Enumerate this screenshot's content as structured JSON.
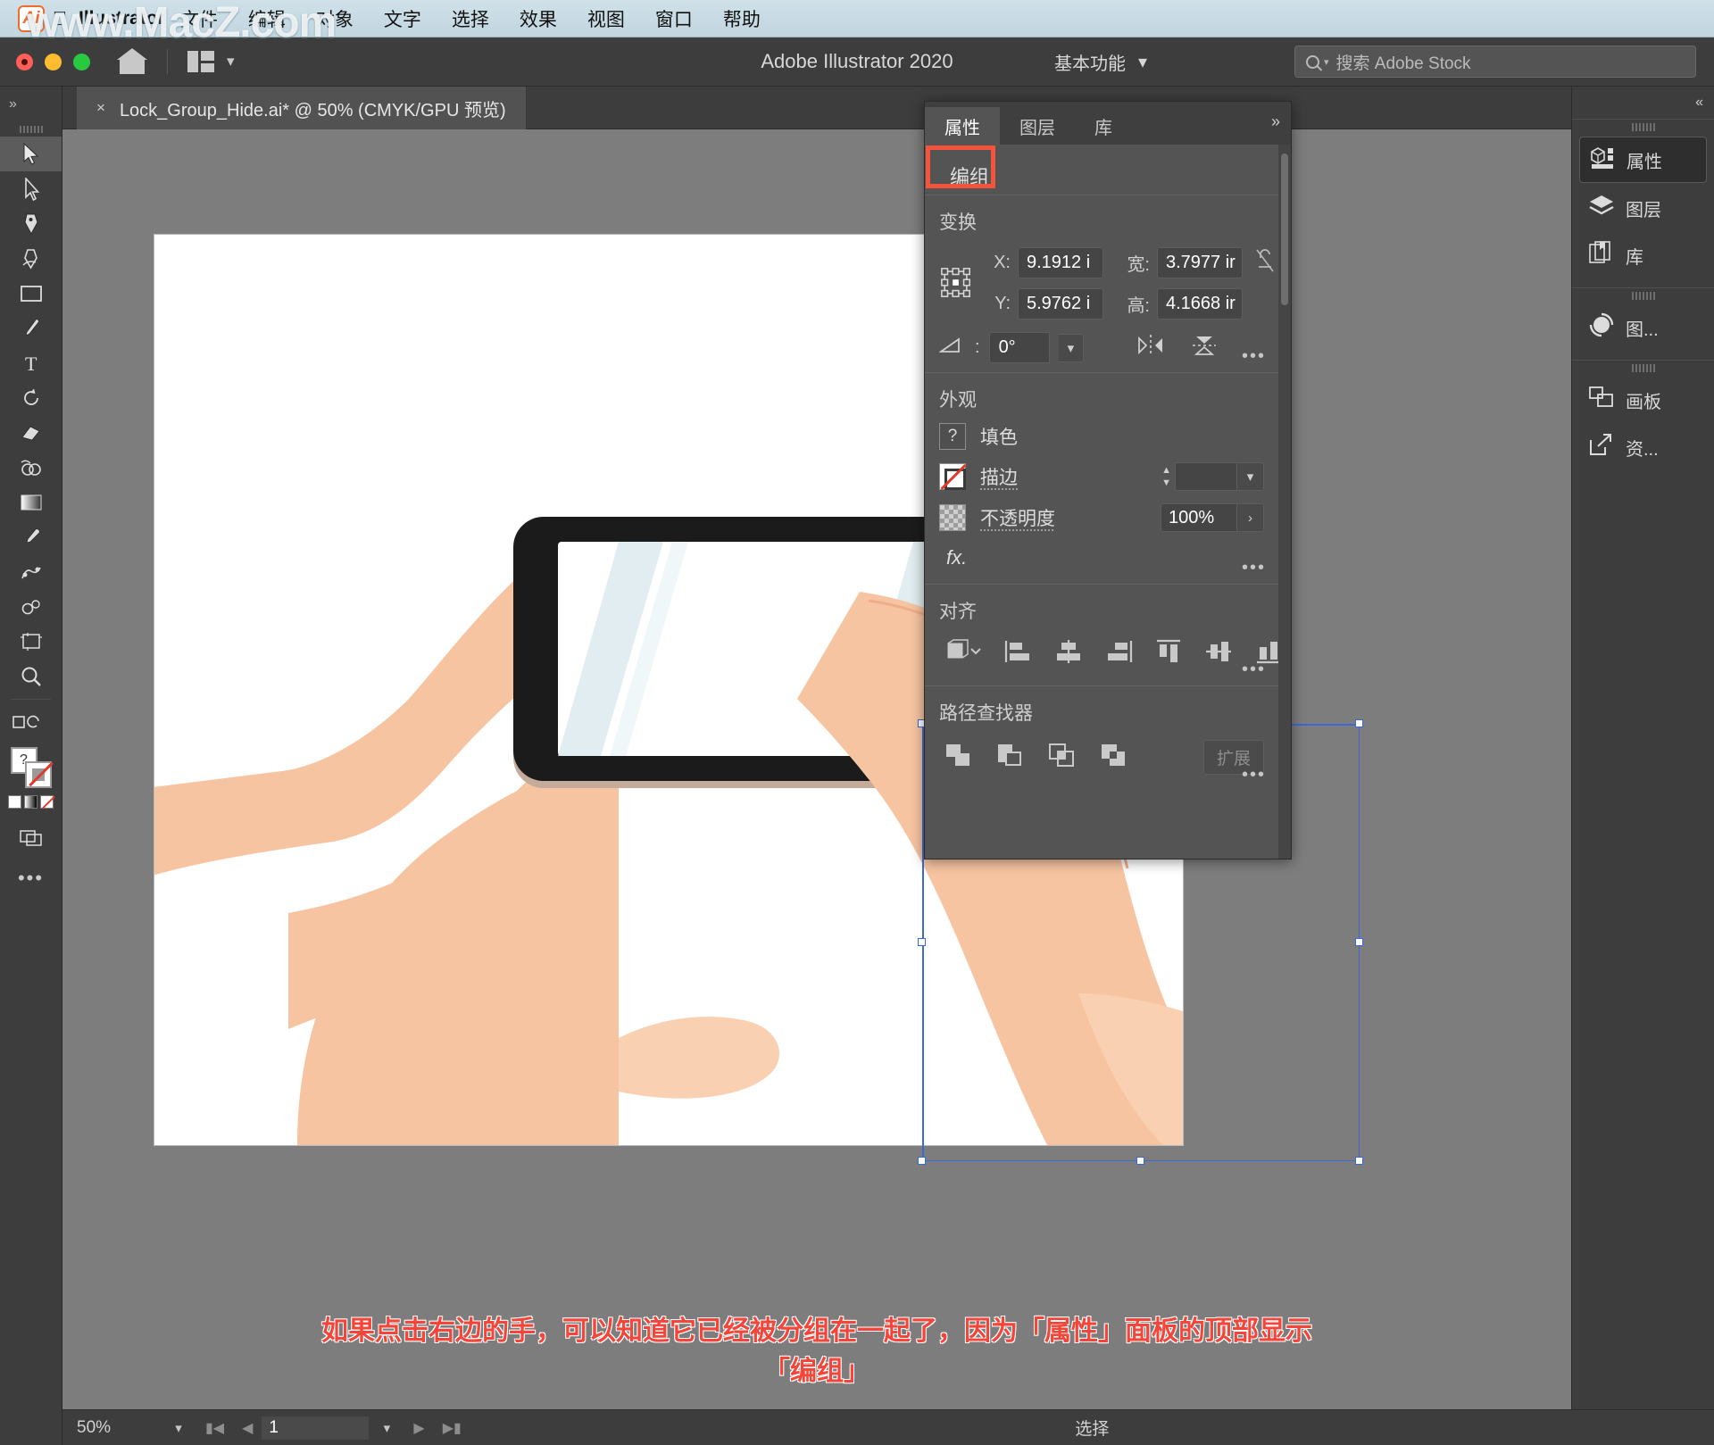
{
  "mac_menu": {
    "app_name": "Illustrator",
    "items": [
      "文件",
      "编辑",
      "对象",
      "文字",
      "选择",
      "效果",
      "视图",
      "窗口",
      "帮助"
    ],
    "watermark": "www.MacZ.com",
    "logo_letter": "Ai"
  },
  "titlebar": {
    "app_title": "Adobe Illustrator 2020",
    "workspace": "基本功能",
    "search_placeholder": "搜索 Adobe Stock",
    "icons": {
      "home": "home-icon",
      "arrange": "arrange-documents-icon",
      "chevron": "chevron-down-icon"
    }
  },
  "document_tab": {
    "close": "×",
    "title": "Lock_Group_Hide.ai* @ 50% (CMYK/GPU 预览)"
  },
  "toolbar": {
    "collapse": "»",
    "tools": [
      {
        "name": "selection-tool",
        "label": "选择工具"
      },
      {
        "name": "direct-selection-tool",
        "label": "直接选择工具"
      },
      {
        "name": "pen-tool",
        "label": "钢笔工具"
      },
      {
        "name": "curvature-tool",
        "label": "曲率工具"
      },
      {
        "name": "rectangle-tool",
        "label": "矩形工具"
      },
      {
        "name": "paintbrush-tool",
        "label": "画笔工具"
      },
      {
        "name": "type-tool",
        "label": "文字工具"
      },
      {
        "name": "rotate-tool",
        "label": "旋转工具"
      },
      {
        "name": "eraser-tool",
        "label": "橡皮擦工具"
      },
      {
        "name": "shape-builder-tool",
        "label": "形状生成器工具"
      },
      {
        "name": "gradient-tool",
        "label": "渐变工具"
      },
      {
        "name": "eyedropper-tool",
        "label": "吸管工具"
      },
      {
        "name": "blend-tool",
        "label": "混合工具"
      },
      {
        "name": "symbol-sprayer-tool",
        "label": "符号喷枪工具"
      },
      {
        "name": "artboard-tool",
        "label": "画板工具"
      },
      {
        "name": "zoom-tool",
        "label": "缩放工具"
      }
    ],
    "more": "•••"
  },
  "properties_panel": {
    "tabs": [
      {
        "label": "属性",
        "active": true
      },
      {
        "label": "图层",
        "active": false
      },
      {
        "label": "库",
        "active": false
      }
    ],
    "more": "»",
    "object_type": "编组",
    "highlight_color": "#f4543c",
    "transform": {
      "title": "变换",
      "x_label": "X:",
      "x_value": "9.1912 i",
      "y_label": "Y:",
      "y_value": "5.9762 i",
      "w_label": "宽:",
      "w_value": "3.7977 ir",
      "h_label": "高:",
      "h_value": "4.1668 ir",
      "angle_value": "0°",
      "more": "•••"
    },
    "appearance": {
      "title": "外观",
      "fill_label": "填色",
      "fill_swatch": "question-mark",
      "stroke_label": "描边",
      "stroke_swatch": "none",
      "stroke_width": "",
      "opacity_label": "不透明度",
      "opacity_value": "100%",
      "fx_label": "fx.",
      "more": "•••"
    },
    "align": {
      "title": "对齐",
      "more": "•••",
      "buttons": [
        "align-to-selection",
        "align-left",
        "align-horizontal-center",
        "align-right",
        "align-top",
        "align-vertical-center",
        "align-bottom"
      ]
    },
    "pathfinder": {
      "title": "路径查找器",
      "expand_label": "扩展",
      "more": "•••",
      "buttons": [
        "unite",
        "minus-front",
        "intersect",
        "exclude"
      ]
    }
  },
  "right_dock": {
    "collapse": "«",
    "groups": [
      {
        "items": [
          {
            "label": "属性",
            "icon": "properties-icon",
            "active": true
          },
          {
            "label": "图层",
            "icon": "layers-icon",
            "active": false
          },
          {
            "label": "库",
            "icon": "libraries-icon",
            "active": false
          }
        ]
      },
      {
        "items": [
          {
            "label": "图...",
            "icon": "symbols-icon",
            "active": false
          }
        ]
      },
      {
        "items": [
          {
            "label": "画板",
            "icon": "artboards-icon",
            "active": false
          },
          {
            "label": "资...",
            "icon": "asset-export-icon",
            "active": false
          }
        ]
      }
    ]
  },
  "status_bar": {
    "zoom": "50%",
    "page": "1",
    "status_text": "选择"
  },
  "caption": {
    "line1": "如果点击右边的手，可以知道它已经被分组在一起了，因为「属性」面板的顶部显示",
    "line2": "「编组」",
    "color": "#f3453a"
  },
  "artwork": {
    "description": "手持智能手机插画",
    "skin_color": "#f7c4a1",
    "skin_shadow": "#f0ad89",
    "phone_body": "#c5ac9a",
    "phone_screen_bezel": "#1b1b1b",
    "screen_color": "#ffffff",
    "screen_highlight": "#d9eaec",
    "selection_color": "#3b6ad8"
  }
}
